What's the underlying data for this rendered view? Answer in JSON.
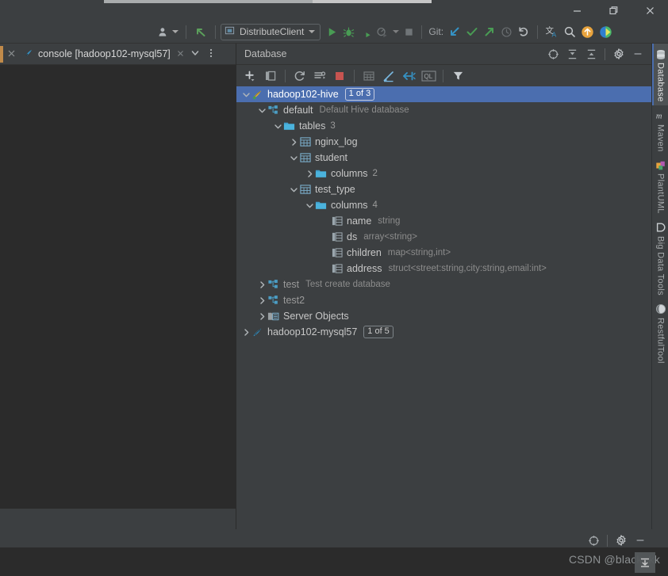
{
  "window": {
    "minimize_label": "—",
    "restore_label": "❐",
    "close_label": "✕"
  },
  "toolbar": {
    "avatar_icon": "user-avatar-icon",
    "back_icon": "back-arrow-icon",
    "run_config": {
      "icon": "module-icon",
      "label": "DistributeClient",
      "dropdown_icon": "chevron-down-icon"
    },
    "run_icon": "run-play-icon",
    "debug_icon": "debug-bug-icon",
    "run_with_coverage_icon": "run-coverage-icon",
    "profile_icon": "profile-icon",
    "profile_dropdown_icon": "chevron-down-icon",
    "stop_icon": "stop-square-icon",
    "git_label": "Git:",
    "update_project_icon": "update-project-arrow-icon",
    "commit_icon": "commit-check-icon",
    "push_icon": "push-arrow-icon",
    "history_icon": "history-clock-icon",
    "rollback_icon": "rollback-undo-icon",
    "translate_icon": "translate-icon",
    "search_everywhere_icon": "search-icon",
    "update_icon": "update-circle-icon",
    "ide_icon": "ide-logo-icon"
  },
  "editor_tabs": {
    "close_icon": "close-icon",
    "tab": {
      "icon": "console-hive-icon",
      "label": "console [hadoop102-mysql57]",
      "close_icon": "close-icon"
    },
    "list_chevron_icon": "chevron-down-icon",
    "more_icon": "more-options-icon"
  },
  "database_panel": {
    "title": "Database",
    "header_icons": [
      {
        "name": "locate-icon",
        "glyph": "⊕"
      },
      {
        "name": "expand-all-icon",
        "glyph": "expand"
      },
      {
        "name": "collapse-all-icon",
        "glyph": "collapse"
      },
      {
        "name": "settings-gear-icon",
        "glyph": "gear"
      },
      {
        "name": "hide-panel-icon",
        "glyph": "—"
      }
    ],
    "toolbar_buttons": [
      {
        "name": "add-data-source-button",
        "glyph": "plus"
      },
      {
        "name": "duplicate-button",
        "glyph": "copy"
      },
      {
        "name": "refresh-button",
        "glyph": "refresh"
      },
      {
        "name": "sync-settings-button",
        "glyph": "sync"
      },
      {
        "name": "stop-button",
        "glyph": "stop"
      },
      {
        "name": "open-table-editor-button",
        "glyph": "table"
      },
      {
        "name": "modify-object-button",
        "glyph": "pencil"
      },
      {
        "name": "jump-to-query-console-button",
        "glyph": "jump"
      },
      {
        "name": "open-ql-console-button",
        "glyph": "ql"
      },
      {
        "name": "filter-button",
        "glyph": "filter"
      }
    ]
  },
  "tree": [
    {
      "id": "hadoop102-hive",
      "depth": 0,
      "arrow": "expanded",
      "icon": "hive-datasource-icon",
      "label": "hadoop102-hive",
      "badge": "1 of 3",
      "selected": true
    },
    {
      "id": "default-schema",
      "depth": 1,
      "arrow": "expanded",
      "icon": "schema-icon",
      "label": "default",
      "sub": "Default Hive database"
    },
    {
      "id": "default-tables",
      "depth": 2,
      "arrow": "expanded",
      "icon": "folder-icon",
      "label": "tables",
      "count": "3"
    },
    {
      "id": "nginx-log-table",
      "depth": 3,
      "arrow": "collapsed",
      "icon": "table-icon",
      "label": "nginx_log"
    },
    {
      "id": "student-table",
      "depth": 3,
      "arrow": "expanded",
      "icon": "table-icon",
      "label": "student"
    },
    {
      "id": "student-columns",
      "depth": 4,
      "arrow": "collapsed",
      "icon": "folder-icon",
      "label": "columns",
      "count": "2"
    },
    {
      "id": "test-type-table",
      "depth": 3,
      "arrow": "expanded",
      "icon": "table-icon",
      "label": "test_type"
    },
    {
      "id": "test-type-columns",
      "depth": 4,
      "arrow": "expanded",
      "icon": "folder-icon",
      "label": "columns",
      "count": "4"
    },
    {
      "id": "column-name",
      "depth": 5,
      "arrow": "none",
      "icon": "column-icon",
      "label": "name",
      "sub": "string"
    },
    {
      "id": "column-ds",
      "depth": 5,
      "arrow": "none",
      "icon": "column-icon",
      "label": "ds",
      "sub": "array<string>"
    },
    {
      "id": "column-children",
      "depth": 5,
      "arrow": "none",
      "icon": "column-icon",
      "label": "children",
      "sub": "map<string,int>"
    },
    {
      "id": "column-address",
      "depth": 5,
      "arrow": "none",
      "icon": "column-icon",
      "label": "address",
      "sub": "struct<street:string,city:string,email:int>"
    },
    {
      "id": "test-schema",
      "depth": 1,
      "arrow": "collapsed",
      "icon": "schema-icon",
      "label": "test",
      "label_muted": true,
      "sub": "Test create database"
    },
    {
      "id": "test2-schema",
      "depth": 1,
      "arrow": "collapsed",
      "icon": "schema-icon",
      "label": "test2",
      "label_muted": true
    },
    {
      "id": "server-objects",
      "depth": 1,
      "arrow": "collapsed",
      "icon": "server-objects-icon",
      "label": "Server Objects"
    },
    {
      "id": "hadoop102-mysql57",
      "depth": 0,
      "arrow": "collapsed",
      "icon": "mysql-datasource-icon",
      "label": "hadoop102-mysql57",
      "badge": "1 of 5"
    }
  ],
  "right_tool_strip": [
    {
      "name": "tool-tab-database",
      "label": "Database",
      "icon": "database-stack-icon",
      "active": true
    },
    {
      "name": "tool-tab-maven",
      "label": "Maven",
      "icon": "maven-m-icon",
      "active": false
    },
    {
      "name": "tool-tab-plantuml",
      "label": "PlantUML",
      "icon": "plantuml-icon",
      "active": false
    },
    {
      "name": "tool-tab-bigdatatools",
      "label": "Big Data Tools",
      "icon": "big-data-tools-icon",
      "active": false
    },
    {
      "name": "tool-tab-restfultool",
      "label": "RestfulTool",
      "icon": "restful-tool-icon",
      "active": false
    }
  ],
  "status_bar": {
    "locate_icon": "locate-icon",
    "settings_icon": "settings-gear-icon",
    "hide_icon": "hide-panel-icon"
  },
  "watermark": {
    "text": "CSDN @black_kk",
    "overlay_icon": "overlay-icon"
  },
  "colors": {
    "bg": "#3c3f41",
    "editor_bg": "#2b2b2b",
    "selection": "#4b6eaf",
    "accent_green": "#499c54",
    "accent_blue": "#3592c4",
    "accent_orange": "#e8a33d",
    "text": "#bbbbbb",
    "text_dim": "#8c8c8c"
  }
}
